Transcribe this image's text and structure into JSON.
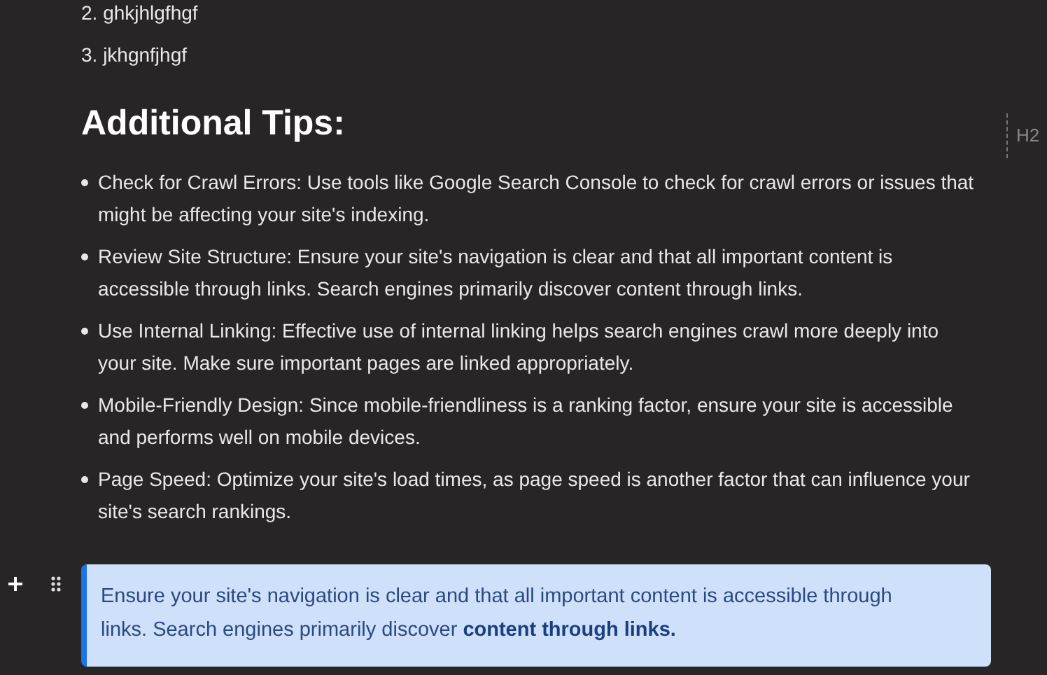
{
  "numbered_list": [
    "2. ghkjhlgfhgf",
    "3. jkhgnfjhgf"
  ],
  "heading": {
    "text": "Additional Tips:",
    "level_badge": "H2"
  },
  "bullets": [
    "Check for Crawl Errors: Use tools like Google Search Console to check for crawl errors or issues that might be affecting your site's indexing.",
    "Review Site Structure: Ensure your site's navigation is clear and that all important content is accessible through links. Search engines primarily discover content through links.",
    "Use Internal Linking: Effective use of internal linking helps search engines crawl more deeply into your site. Make sure important pages are linked appropriately.",
    "Mobile-Friendly Design: Since mobile-friendliness is a ranking factor, ensure your site is accessible and performs well on mobile devices.",
    "Page Speed: Optimize your site's load times, as page speed is another factor that can influence your site's search rankings."
  ],
  "callout": {
    "text": "Ensure your site's navigation is clear and that all important content is accessible through links. Search engines primarily discover **content through links.**"
  }
}
